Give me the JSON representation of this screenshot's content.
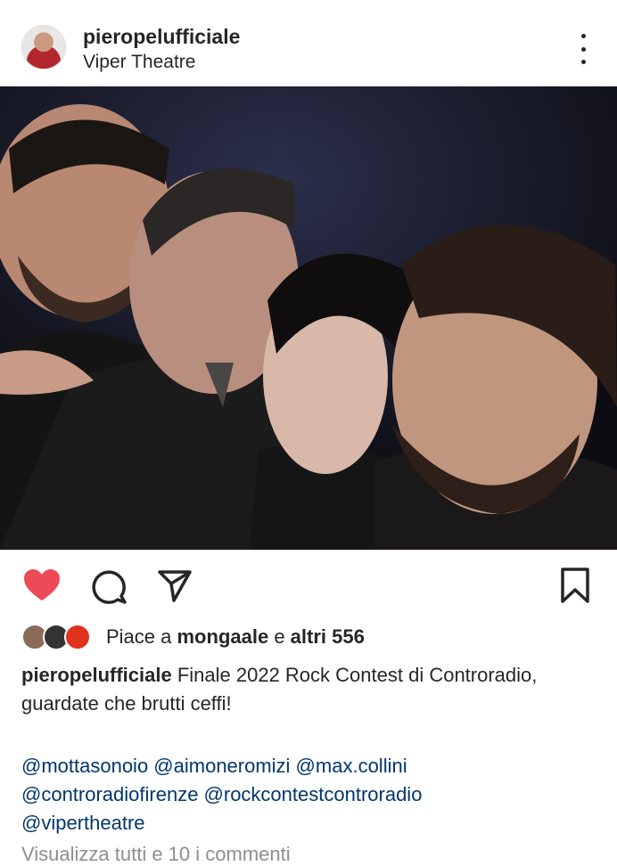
{
  "post": {
    "username": "pieropelufficiale",
    "location": "Viper Theatre"
  },
  "likes": {
    "prefix": "Piace a ",
    "user": "mongaale",
    "middle": " e ",
    "others": "altri 556"
  },
  "caption": {
    "username": "pieropelufficiale",
    "text": " Finale 2022 Rock Contest di Controradio, guardate che brutti ceffi!"
  },
  "mentions": [
    "@mottasonoio @aimoneromizi @max.collini",
    "@controradiofirenze @rockcontestcontroradio",
    "@vipertheatre"
  ],
  "comments_link_partial": "Visualizza tutti e 10 i commenti",
  "colors": {
    "like": "#ed4956",
    "mention": "#00376b",
    "text": "#262626"
  }
}
